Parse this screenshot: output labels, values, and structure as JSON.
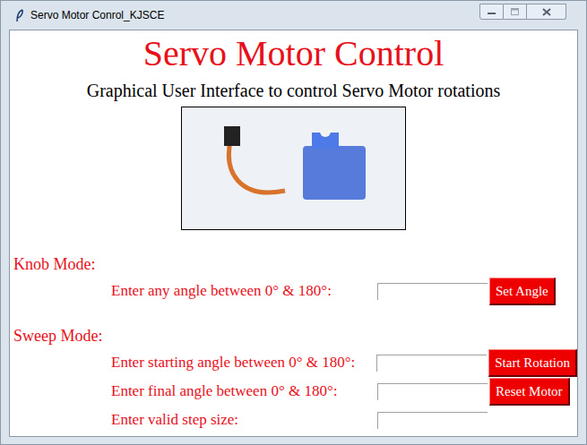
{
  "window": {
    "title": "Servo Motor Conrol_KJSCE"
  },
  "heading": "Servo Motor Control",
  "subtitle": "Graphical User Interface to control Servo Motor rotations",
  "knob": {
    "label": "Knob Mode:",
    "rows": [
      {
        "label": "Enter any angle between 0° & 180°:",
        "value": "",
        "button": "Set Angle"
      }
    ]
  },
  "sweep": {
    "label": "Sweep Mode:",
    "rows": [
      {
        "label": "Enter starting angle between 0° & 180°:",
        "value": "",
        "button": "Start Rotation"
      },
      {
        "label": "Enter final angle between 0° & 180°:",
        "value": "",
        "button": "Reset Motor"
      },
      {
        "label": "Enter valid step size:",
        "value": ""
      }
    ]
  }
}
